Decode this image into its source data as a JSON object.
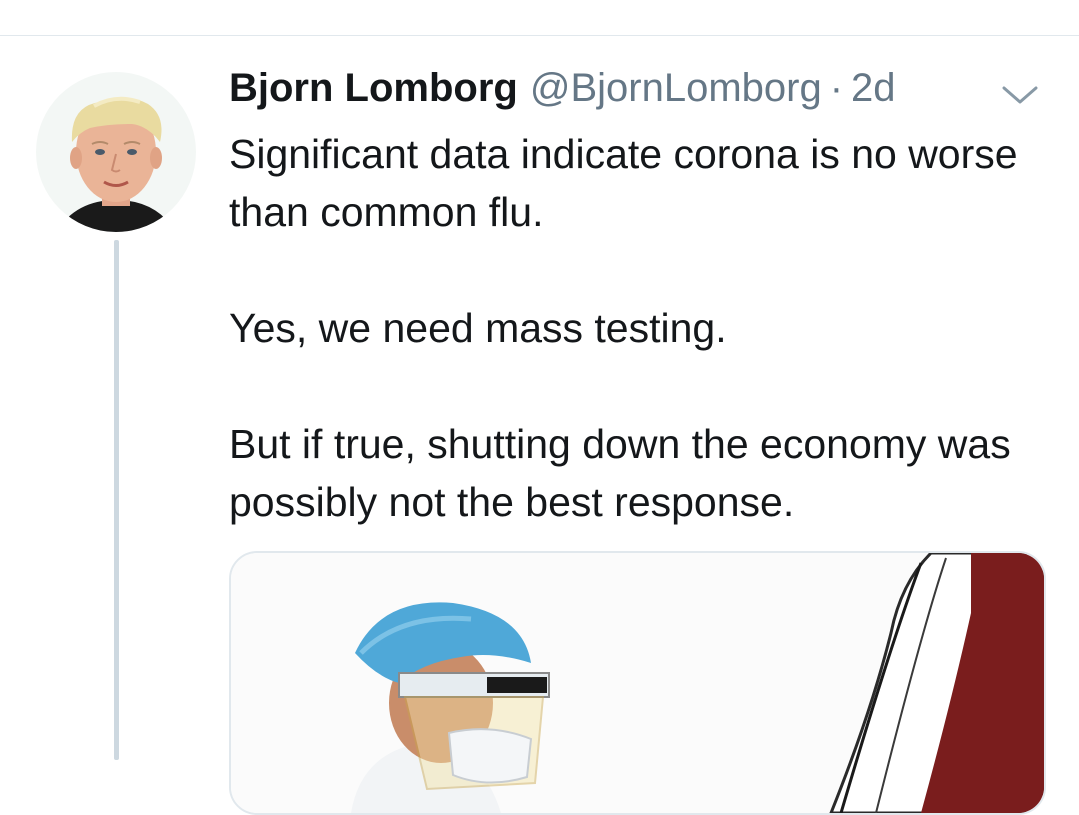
{
  "tweet": {
    "display_name": "Bjorn Lomborg",
    "handle": "@BjornLomborg",
    "separator": "·",
    "time": "2d",
    "paragraphs": [
      "Significant data indicate corona is no worse than common flu.",
      "Yes, we need mass testing.",
      "But if true, shutting down the economy was possibly not the best response."
    ]
  },
  "icons": {
    "menu": "chevron-down-icon"
  },
  "colors": {
    "text_primary": "#14171a",
    "text_secondary": "#657786",
    "divider": "#e1e8ed",
    "thread_line": "#cdd8e0"
  }
}
